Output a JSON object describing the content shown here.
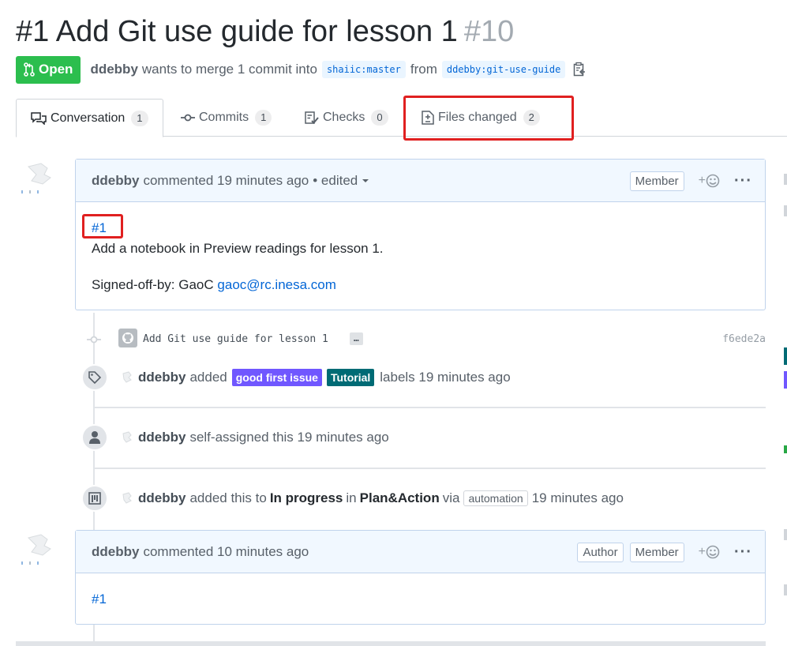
{
  "pr": {
    "title": "#1 Add Git use guide for lesson 1",
    "number": "#10",
    "state": "Open",
    "author": "ddebby",
    "meta_text": "wants to merge 1 commit into",
    "base_branch": "shaiic:master",
    "from_text": "from",
    "head_branch": "ddebby:git-use-guide"
  },
  "tabs": [
    {
      "label": "Conversation",
      "count": "1"
    },
    {
      "label": "Commits",
      "count": "1"
    },
    {
      "label": "Checks",
      "count": "0"
    },
    {
      "label": "Files changed",
      "count": "2"
    }
  ],
  "comment1": {
    "author": "ddebby",
    "action": "commented 19 minutes ago",
    "edited": "• edited",
    "role": "Member",
    "react_plus": "+",
    "link": "#1",
    "line1": "Add a notebook in Preview readings for lesson 1.",
    "signed_prefix": "Signed-off-by: GaoC",
    "email": "gaoc@rc.inesa.com"
  },
  "commit": {
    "message": "Add Git use guide for lesson 1",
    "ellipsis": "…",
    "sha": "f6ede2a"
  },
  "events": {
    "labels": {
      "author": "ddebby",
      "verb": "added",
      "label1": "good first issue",
      "label1_color": "#7057ff",
      "label2": "Tutorial",
      "label2_color": "#006b75",
      "suffix": "labels 19 minutes ago"
    },
    "assign": {
      "author": "ddebby",
      "text": "self-assigned this 19 minutes ago"
    },
    "project": {
      "author": "ddebby",
      "verb": "added this to",
      "column": "In progress",
      "in": "in",
      "project": "Plan&Action",
      "via": "via",
      "app": "automation",
      "time": "19 minutes ago"
    }
  },
  "comment2": {
    "author": "ddebby",
    "action": "commented 10 minutes ago",
    "role1": "Author",
    "role2": "Member",
    "react_plus": "+",
    "link": "#1"
  },
  "colors": {
    "open_green": "#2cbe4e",
    "link_blue": "#0366d6",
    "highlight_red": "#e02020"
  }
}
